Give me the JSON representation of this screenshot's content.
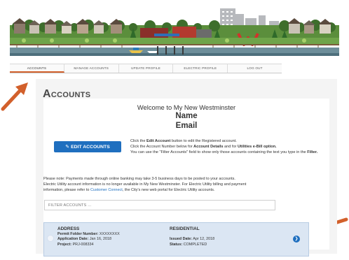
{
  "nav": {
    "tabs": [
      {
        "label": "ACCOUNTS",
        "active": true
      },
      {
        "label": "MANAGE ACCOUNTS",
        "active": false
      },
      {
        "label": "UPDATE PROFILE",
        "active": false
      },
      {
        "label": "ELECTRIC PROFILE",
        "active": false
      },
      {
        "label": "LOG OUT",
        "active": false
      }
    ]
  },
  "page": {
    "title": "Accounts",
    "welcome": "Welcome to My New Westminster",
    "name": "Name",
    "email": "Email"
  },
  "edit_button": {
    "label": "EDIT ACCOUNTS",
    "icon": "pencil-icon"
  },
  "instructions": {
    "line1_a": "Click the ",
    "line1_b": "Edit Account",
    "line1_c": " button to edit the Registered account.",
    "line2_a": "Click the Account Number below for ",
    "line2_b": "Account Details",
    "line2_c": " and for ",
    "line2_d": "Utilities e-Bill option.",
    "line3": "You can use the \"Filter Accounts\" field to show only those accounts containing the text you type in the ",
    "line3_b": "Filter."
  },
  "notes": {
    "line1": "Please note: Payments made through online banking may take 3-5 business days to be posted to your accounts.",
    "line2": "Electric Utility account information is no longer available in My New Westminster. For Electric Utility billing and payment",
    "line3_a": "information, please refer to ",
    "line3_link": "Customer Connect",
    "line3_b": ", the City's new web portal for Electric Utility accounts."
  },
  "filter": {
    "placeholder": "FILTER ACCOUNTS ..."
  },
  "account": {
    "header_left": "ADDRESS",
    "header_right": "RESIDENTIAL",
    "permit_label": "Permit Folder Number:",
    "permit_value": "XXXXXXXX",
    "app_date_label": "Application Date:",
    "app_date_value": "Jan 16, 2018",
    "project_label": "Project:",
    "project_value": "PRJ-008334",
    "issued_label": "Issued Date:",
    "issued_value": "Apr 12, 2018",
    "status_label": "Status:",
    "status_value": "COMPLETED",
    "arrow_icon": "chevron-right-icon"
  },
  "colors": {
    "accent": "#1f6fbf",
    "arrow": "#d2602b",
    "card": "#dbe6f3",
    "panel": "#f4f4f4"
  }
}
